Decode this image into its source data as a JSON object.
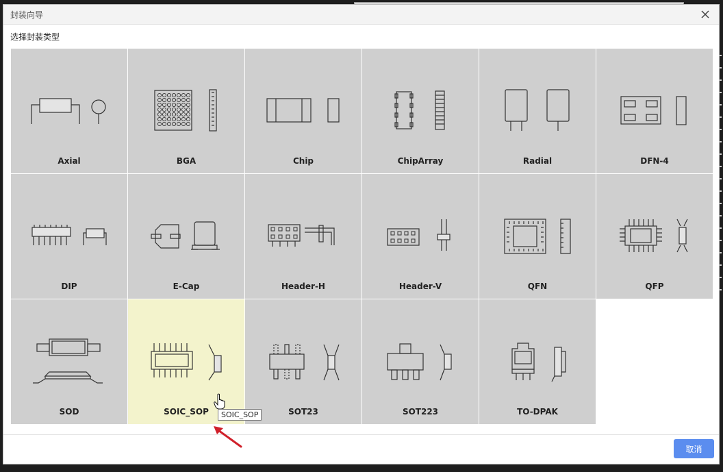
{
  "dialog": {
    "title": "封装向导",
    "subtitle": "选择封装类型",
    "cancel_label": "取消"
  },
  "packages": [
    {
      "label": "Axial",
      "icon": "axial-package-icon"
    },
    {
      "label": "BGA",
      "icon": "bga-package-icon"
    },
    {
      "label": "Chip",
      "icon": "chip-package-icon"
    },
    {
      "label": "ChipArray",
      "icon": "chiparray-package-icon"
    },
    {
      "label": "Radial",
      "icon": "radial-package-icon"
    },
    {
      "label": "DFN-4",
      "icon": "dfn4-package-icon"
    },
    {
      "label": "DIP",
      "icon": "dip-package-icon"
    },
    {
      "label": "E-Cap",
      "icon": "ecap-package-icon"
    },
    {
      "label": "Header-H",
      "icon": "header-h-package-icon"
    },
    {
      "label": "Header-V",
      "icon": "header-v-package-icon"
    },
    {
      "label": "QFN",
      "icon": "qfn-package-icon"
    },
    {
      "label": "QFP",
      "icon": "qfp-package-icon"
    },
    {
      "label": "SOD",
      "icon": "sod-package-icon"
    },
    {
      "label": "SOIC_SOP",
      "icon": "soic-sop-package-icon",
      "hovered": true
    },
    {
      "label": "SOT23",
      "icon": "sot23-package-icon"
    },
    {
      "label": "SOT223",
      "icon": "sot223-package-icon"
    },
    {
      "label": "TO-DPAK",
      "icon": "to-dpak-package-icon"
    }
  ],
  "tooltip": "SOIC_SOP",
  "colors": {
    "card_bg": "#cfcfcf",
    "card_hover_bg": "#f3f3cc",
    "primary_button": "#5b8def",
    "annotation_arrow": "#d0202a"
  }
}
